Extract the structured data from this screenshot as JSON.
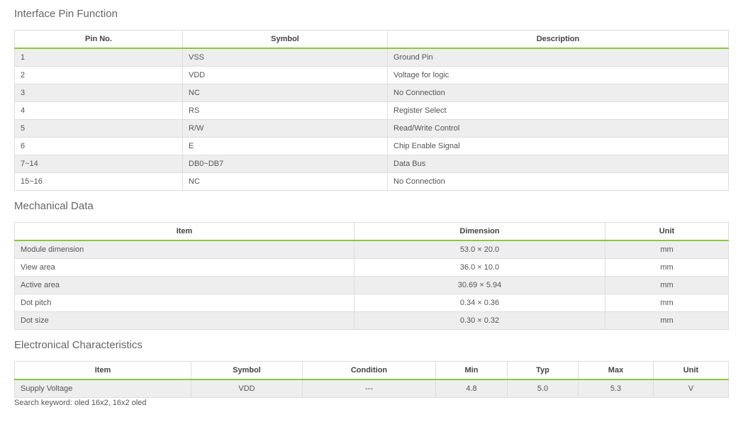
{
  "pin": {
    "title": "Interface Pin Function",
    "headers": [
      "Pin No.",
      "Symbol",
      "Description"
    ],
    "rows": [
      [
        "1",
        "VSS",
        "Ground Pin"
      ],
      [
        "2",
        "VDD",
        "Voltage for logic"
      ],
      [
        "3",
        "NC",
        "No Connection"
      ],
      [
        "4",
        "RS",
        "Register Select"
      ],
      [
        "5",
        "R/W",
        "Read/Write Control"
      ],
      [
        "6",
        "E",
        "Chip Enable Signal"
      ],
      [
        "7~14",
        "DB0~DB7",
        "Data Bus"
      ],
      [
        "15~16",
        "NC",
        "No Connection"
      ]
    ]
  },
  "mech": {
    "title": "Mechanical Data",
    "headers": [
      "Item",
      "Dimension",
      "Unit"
    ],
    "rows": [
      [
        "Module dimension",
        "53.0 × 20.0",
        "mm"
      ],
      [
        "View area",
        "36.0 × 10.0",
        "mm"
      ],
      [
        "Active area",
        "30.69 × 5.94",
        "mm"
      ],
      [
        "Dot pitch",
        "0.34 × 0.36",
        "mm"
      ],
      [
        "Dot size",
        "0.30 × 0.32",
        "mm"
      ]
    ]
  },
  "elec": {
    "title": "Electronical Characteristics",
    "headers": [
      "Item",
      "Symbol",
      "Condition",
      "Min",
      "Typ",
      "Max",
      "Unit"
    ],
    "rows": [
      [
        "Supply Voltage",
        "VDD",
        "---",
        "4.8",
        "5.0",
        "5.3",
        "V"
      ]
    ]
  },
  "keyword": "Search keyword: oled 16x2, 16x2 oled"
}
